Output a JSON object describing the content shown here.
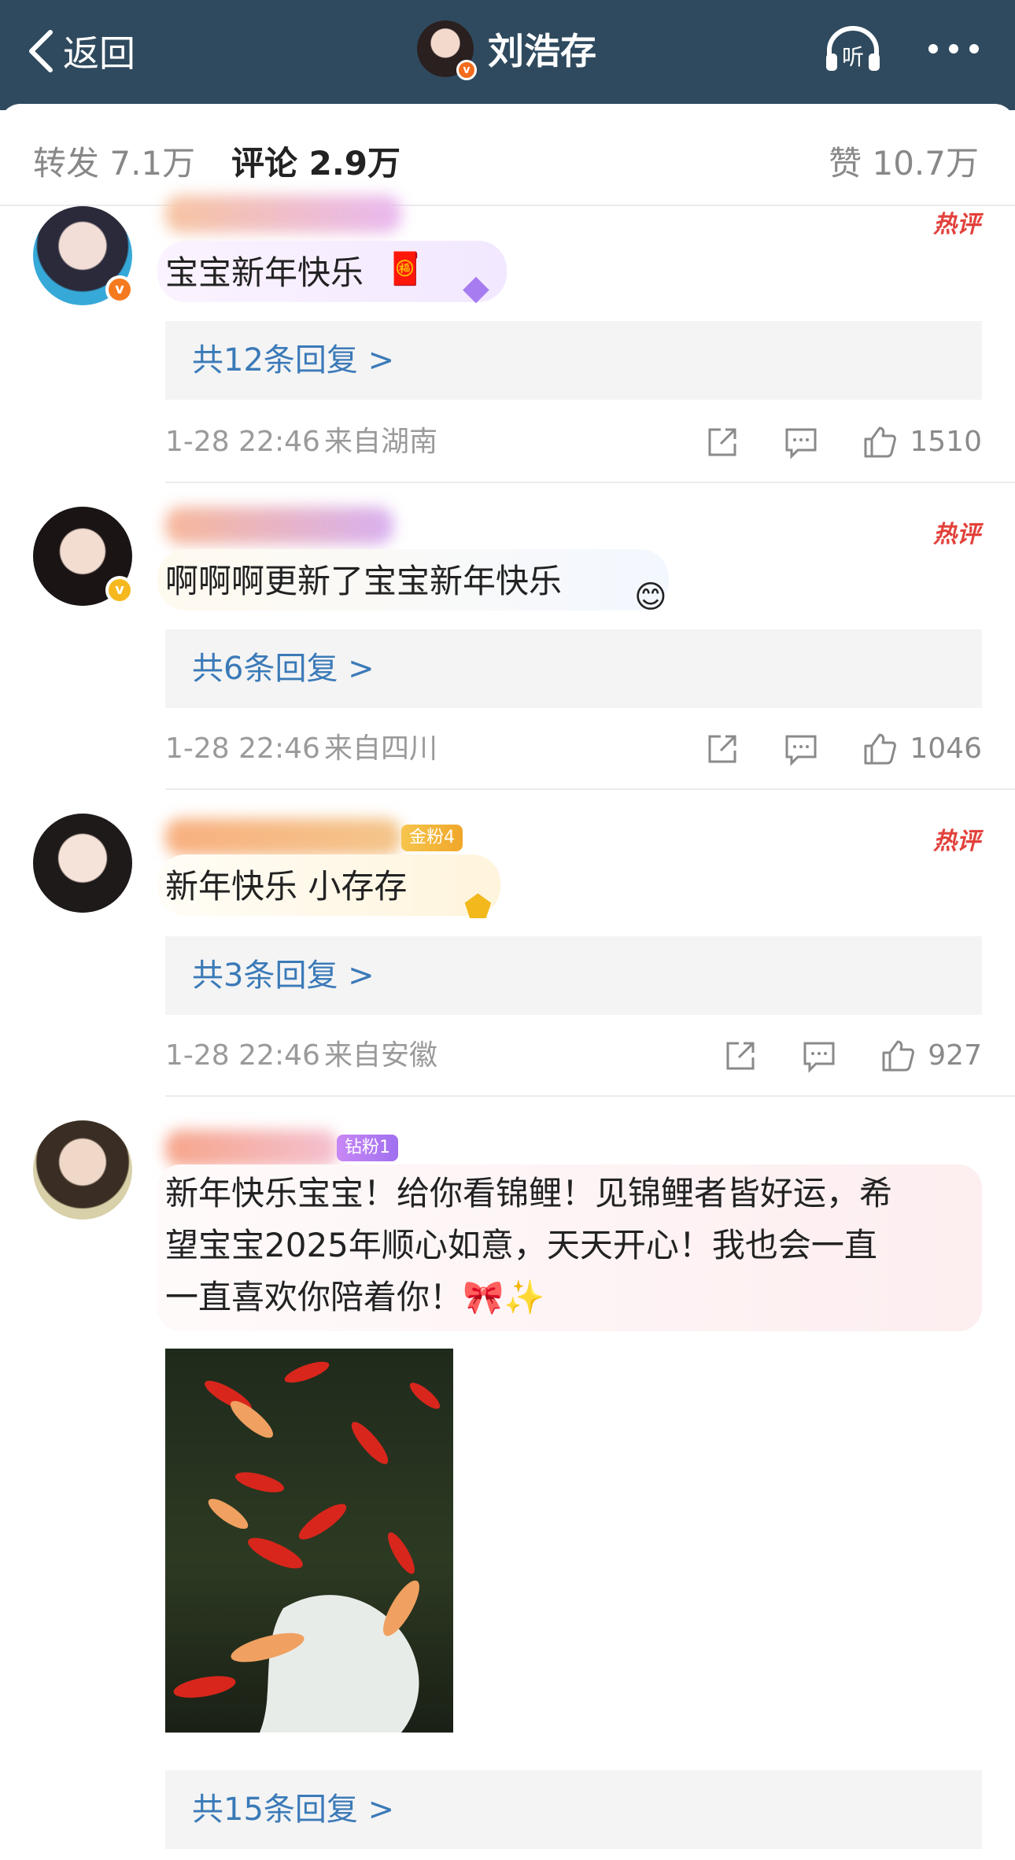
{
  "nav": {
    "back_label": "返回",
    "title": "刘浩存",
    "listen_label": "听"
  },
  "tabs": {
    "repost": "转发 7.1万",
    "comment": "评论 2.9万",
    "like": "赞 10.7万"
  },
  "colors": {
    "nav_bg": "#2f4a5e",
    "reply_link": "#3b7ab8",
    "hot_label": "#e2413b",
    "meta_text": "#9a9a9a"
  },
  "comments": [
    {
      "hot_label": "热评",
      "text": "宝宝新年快乐",
      "replies": "共12条回复 >",
      "time": "1-28 22:46",
      "source": "来自湖南",
      "likes": "1510"
    },
    {
      "hot_label": "热评",
      "text": "啊啊啊更新了宝宝新年快乐",
      "replies": "共6条回复 >",
      "time": "1-28 22:46",
      "source": "来自四川",
      "likes": "1046"
    },
    {
      "hot_label": "热评",
      "fan_badge": "金粉4",
      "text": "新年快乐 小存存",
      "replies": "共3条回复 >",
      "time": "1-28 22:46",
      "source": "来自安徽",
      "likes": "927"
    },
    {
      "fan_badge": "钻粉1",
      "text_lines": [
        "新年快乐宝宝！给你看锦鲤！见锦鲤者皆好运，希",
        "望宝宝2025年顺心如意，天天开心！我也会一直",
        "一直喜欢你陪着你！🎀✨"
      ],
      "replies": "共15条回复 >"
    }
  ]
}
